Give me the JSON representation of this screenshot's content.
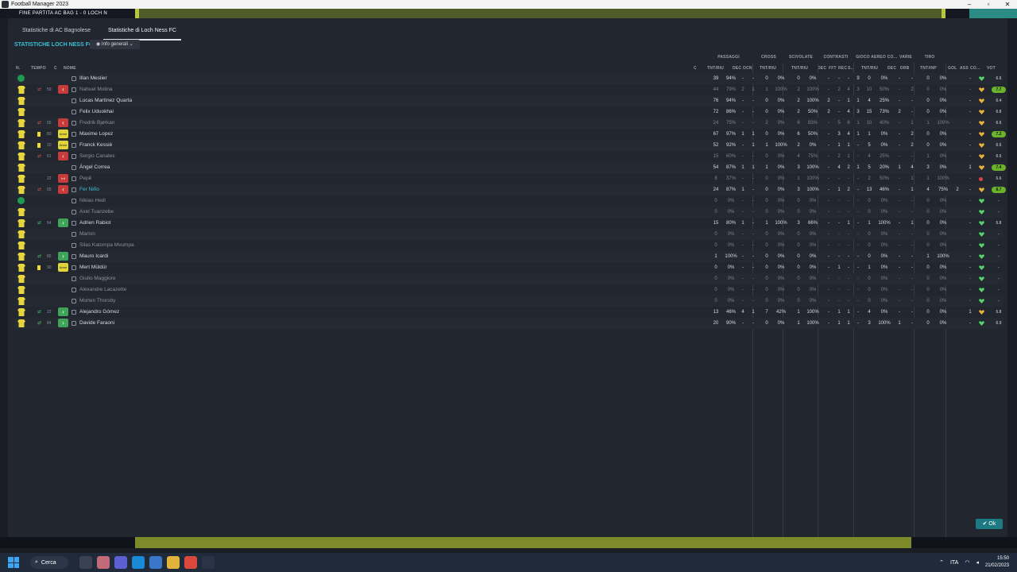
{
  "window": {
    "title": "Football Manager 2023"
  },
  "gamebar": {
    "left_text": "FINE PARTITA   AC BAG   1 - 0   LOCH N"
  },
  "tabs": [
    {
      "label": "Statistiche di AC Bagnolese"
    },
    {
      "label": "Statistiche di Loch Ness FC"
    }
  ],
  "section_title": "STATISTICHE LOCH NESS FC",
  "view_dropdown": {
    "label": "Info generali"
  },
  "groups": [
    "PASSAGGI",
    "CROSS",
    "SCIVOLATE",
    "CONTRASTI",
    "GIOCO AEREO",
    "CO...",
    "VARIE",
    "TIRO"
  ],
  "columns": {
    "n": "N.",
    "tempo": "TEMPO",
    "c": "C",
    "nome": "NOME",
    "cc": "C",
    "pass_tnt": "TNT/RIU",
    "pass_dec": "DEC",
    "pass_occ": "OCN",
    "cross_tnt": "TNT/RIU",
    "sciv_tnt": "TNT/RIU",
    "con_dec": "DEC",
    "con_fft": "FFT",
    "con_rec": "REC",
    "con_s": "S...",
    "aereo_tnt": "TNT/RIU",
    "co_dec": "DEC",
    "varie_drb": "DRB",
    "tiro_tnt": "TNT/INP",
    "gol": "GOL",
    "ass": "ASS",
    "co2": "CO...",
    "vot": "VOT"
  },
  "players": [
    {
      "name": "Illan Meslier",
      "state": "normal",
      "badge": "pos",
      "mins": "",
      "pass": "39",
      "passp": "94%",
      "pdec": "-",
      "pocc": "-",
      "cr": "0",
      "crp": "0%",
      "sc": "0",
      "scp": "0%",
      "cd": "-",
      "cf": "-",
      "cre": "-",
      "cs": "9",
      "ae": "0",
      "aep": "0%",
      "cod": "-",
      "drb": "-",
      "ti": "0",
      "tip": "0%",
      "gol": "",
      "ass": "-",
      "mood": "g",
      "vot": "6.6",
      "votpill": false
    },
    {
      "name": "Nahuel Molina",
      "state": "dim",
      "badge": "out",
      "mins": "59",
      "pass": "44",
      "passp": "79%",
      "pdec": "2",
      "pocc": "1",
      "cr": "1",
      "crp": "100%",
      "sc": "2",
      "scp": "100%",
      "cd": "-",
      "cf": "2",
      "cre": "4",
      "cs": "3",
      "ae": "10",
      "aep": "50%",
      "cod": "-",
      "drb": "2",
      "ti": "0",
      "tip": "0%",
      "gol": "",
      "ass": "-",
      "mood": "y",
      "vot": "7.7",
      "votpill": true
    },
    {
      "name": "Lucas Martínez Quarta",
      "state": "normal",
      "badge": "",
      "mins": "",
      "pass": "76",
      "passp": "94%",
      "pdec": "-",
      "pocc": "-",
      "cr": "0",
      "crp": "0%",
      "sc": "2",
      "scp": "100%",
      "cd": "2",
      "cf": "-",
      "cre": "1",
      "cs": "1",
      "ae": "4",
      "aep": "25%",
      "cod": "-",
      "drb": "-",
      "ti": "0",
      "tip": "0%",
      "gol": "",
      "ass": "-",
      "mood": "y",
      "vot": "6.4",
      "votpill": false
    },
    {
      "name": "Felix Uduokhai",
      "state": "normal",
      "badge": "",
      "mins": "",
      "pass": "72",
      "passp": "86%",
      "pdec": "-",
      "pocc": "-",
      "cr": "0",
      "crp": "0%",
      "sc": "2",
      "scp": "50%",
      "cd": "2",
      "cf": "-",
      "cre": "4",
      "cs": "3",
      "ae": "15",
      "aep": "73%",
      "cod": "2",
      "drb": "-",
      "ti": "0",
      "tip": "0%",
      "gol": "",
      "ass": "-",
      "mood": "y",
      "vot": "6.8",
      "votpill": false
    },
    {
      "name": "Fredrik Bjørkan",
      "state": "dim",
      "badge": "out",
      "mins": "55",
      "pass": "24",
      "passp": "75%",
      "pdec": "-",
      "pocc": "-",
      "cr": "2",
      "crp": "0%",
      "sc": "6",
      "scp": "83%",
      "cd": "-",
      "cf": "5",
      "cre": "6",
      "cs": "1",
      "ae": "10",
      "aep": "40%",
      "cod": "-",
      "drb": "1",
      "ti": "1",
      "tip": "100%",
      "gol": "",
      "ass": "-",
      "mood": "y",
      "vot": "6.6",
      "votpill": false
    },
    {
      "name": "Maxime Lopez",
      "state": "normal",
      "badge": "card",
      "mins": "80",
      "pass": "67",
      "passp": "97%",
      "pdec": "1",
      "pocc": "1",
      "cr": "0",
      "crp": "0%",
      "sc": "6",
      "scp": "50%",
      "cd": "-",
      "cf": "3",
      "cre": "4",
      "cs": "1",
      "ae": "1",
      "aep": "0%",
      "cod": "-",
      "drb": "2",
      "ti": "0",
      "tip": "0%",
      "gol": "",
      "ass": "-",
      "mood": "y",
      "vot": "7.2",
      "votpill": true
    },
    {
      "name": "Franck Kessié",
      "state": "normal",
      "badge": "card",
      "mins": "10",
      "pass": "52",
      "passp": "92%",
      "pdec": "-",
      "pocc": "1",
      "cr": "1",
      "crp": "100%",
      "sc": "2",
      "scp": "0%",
      "cd": "-",
      "cf": "1",
      "cre": "1",
      "cs": "-",
      "ae": "5",
      "aep": "0%",
      "cod": "-",
      "drb": "2",
      "ti": "0",
      "tip": "0%",
      "gol": "",
      "ass": "-",
      "mood": "y",
      "vot": "6.6",
      "votpill": false
    },
    {
      "name": "Sergio Canales",
      "state": "dim",
      "badge": "out",
      "mins": "61",
      "pass": "15",
      "passp": "60%",
      "pdec": "-",
      "pocc": "-",
      "cr": "0",
      "crp": "0%",
      "sc": "4",
      "scp": "75%",
      "cd": "-",
      "cf": "2",
      "cre": "1",
      "cs": "-",
      "ae": "4",
      "aep": "25%",
      "cod": "-",
      "drb": "-",
      "ti": "1",
      "tip": "0%",
      "gol": "",
      "ass": "-",
      "mood": "y",
      "vot": "6.6",
      "votpill": false
    },
    {
      "name": "Ángel Correa",
      "state": "normal",
      "badge": "",
      "mins": "",
      "pass": "54",
      "passp": "87%",
      "pdec": "1",
      "pocc": "1",
      "cr": "1",
      "crp": "0%",
      "sc": "3",
      "scp": "100%",
      "cd": "-",
      "cf": "4",
      "cre": "2",
      "cs": "1",
      "ae": "5",
      "aep": "20%",
      "cod": "1",
      "drb": "4",
      "ti": "3",
      "tip": "0%",
      "gol": "",
      "ass": "1",
      "mood": "y",
      "vot": "7.4",
      "votpill": true
    },
    {
      "name": "Pepê",
      "state": "dim",
      "badge": "inj",
      "mins": "22",
      "pass": "8",
      "passp": "37%",
      "pdec": "-",
      "pocc": "-",
      "cr": "0",
      "crp": "0%",
      "sc": "1",
      "scp": "100%",
      "cd": "-",
      "cf": "-",
      "cre": "-",
      "cs": "-",
      "ae": "2",
      "aep": "50%",
      "cod": "-",
      "drb": "1",
      "ti": "1",
      "tip": "100%",
      "gol": "",
      "ass": "-",
      "mood": "r",
      "vot": "6.6",
      "votpill": false
    },
    {
      "name": "Fer Niño",
      "state": "hl",
      "badge": "out",
      "mins": "55",
      "pass": "24",
      "passp": "87%",
      "pdec": "1",
      "pocc": "-",
      "cr": "0",
      "crp": "0%",
      "sc": "3",
      "scp": "100%",
      "cd": "-",
      "cf": "1",
      "cre": "2",
      "cs": "-",
      "ae": "13",
      "aep": "46%",
      "cod": "-",
      "drb": "1",
      "ti": "4",
      "tip": "75%",
      "gol": "2",
      "ass": "-",
      "mood": "y",
      "vot": "8.7",
      "votpill": true
    },
    {
      "name": "Niklas Hedl",
      "state": "dim",
      "badge": "pos",
      "mins": "",
      "pass": "0",
      "passp": "0%",
      "pdec": "-",
      "pocc": "-",
      "cr": "0",
      "crp": "0%",
      "sc": "0",
      "scp": "0%",
      "cd": "-",
      "cf": "-",
      "cre": "-",
      "cs": "-",
      "ae": "0",
      "aep": "0%",
      "cod": "-",
      "drb": "-",
      "ti": "0",
      "tip": "0%",
      "gol": "",
      "ass": "-",
      "mood": "g",
      "vot": "-",
      "votpill": false
    },
    {
      "name": "Axel Tuanzebe",
      "state": "dim",
      "badge": "",
      "mins": "",
      "pass": "0",
      "passp": "0%",
      "pdec": "-",
      "pocc": "-",
      "cr": "0",
      "crp": "0%",
      "sc": "0",
      "scp": "0%",
      "cd": "-",
      "cf": "-",
      "cre": "-",
      "cs": "-",
      "ae": "0",
      "aep": "0%",
      "cod": "-",
      "drb": "-",
      "ti": "0",
      "tip": "0%",
      "gol": "",
      "ass": "-",
      "mood": "g",
      "vot": "-",
      "votpill": false
    },
    {
      "name": "Adrien Rabiot",
      "state": "normal",
      "badge": "in",
      "mins": "64",
      "pass": "15",
      "passp": "80%",
      "pdec": "1",
      "pocc": "-",
      "cr": "1",
      "crp": "100%",
      "sc": "3",
      "scp": "66%",
      "cd": "-",
      "cf": "-",
      "cre": "1",
      "cs": "-",
      "ae": "1",
      "aep": "100%",
      "cod": "-",
      "drb": "1",
      "ti": "0",
      "tip": "0%",
      "gol": "",
      "ass": "-",
      "mood": "g",
      "vot": "6.8",
      "votpill": false
    },
    {
      "name": "Marlon",
      "state": "dim",
      "badge": "",
      "mins": "",
      "pass": "0",
      "passp": "0%",
      "pdec": "-",
      "pocc": "-",
      "cr": "0",
      "crp": "0%",
      "sc": "0",
      "scp": "0%",
      "cd": "-",
      "cf": "-",
      "cre": "-",
      "cs": "-",
      "ae": "0",
      "aep": "0%",
      "cod": "-",
      "drb": "-",
      "ti": "0",
      "tip": "0%",
      "gol": "",
      "ass": "-",
      "mood": "g",
      "vot": "-",
      "votpill": false
    },
    {
      "name": "Silas Katompa Mvumpa",
      "state": "dim",
      "badge": "",
      "mins": "",
      "pass": "0",
      "passp": "0%",
      "pdec": "-",
      "pocc": "-",
      "cr": "0",
      "crp": "0%",
      "sc": "0",
      "scp": "0%",
      "cd": "-",
      "cf": "-",
      "cre": "-",
      "cs": "-",
      "ae": "0",
      "aep": "0%",
      "cod": "-",
      "drb": "-",
      "ti": "0",
      "tip": "0%",
      "gol": "",
      "ass": "-",
      "mood": "g",
      "vot": "-",
      "votpill": false
    },
    {
      "name": "Mauro Icardi",
      "state": "normal",
      "badge": "in",
      "mins": "85",
      "pass": "1",
      "passp": "100%",
      "pdec": "-",
      "pocc": "-",
      "cr": "0",
      "crp": "0%",
      "sc": "0",
      "scp": "0%",
      "cd": "-",
      "cf": "-",
      "cre": "-",
      "cs": "-",
      "ae": "0",
      "aep": "0%",
      "cod": "-",
      "drb": "-",
      "ti": "1",
      "tip": "100%",
      "gol": "",
      "ass": "-",
      "mood": "g",
      "vot": "-",
      "votpill": false
    },
    {
      "name": "Mert Müldür",
      "state": "normal",
      "badge": "card",
      "mins": "90",
      "pass": "0",
      "passp": "0%",
      "pdec": "-",
      "pocc": "-",
      "cr": "0",
      "crp": "0%",
      "sc": "0",
      "scp": "0%",
      "cd": "-",
      "cf": "1",
      "cre": "-",
      "cs": "-",
      "ae": "1",
      "aep": "0%",
      "cod": "-",
      "drb": "-",
      "ti": "0",
      "tip": "0%",
      "gol": "",
      "ass": "-",
      "mood": "g",
      "vot": "-",
      "votpill": false
    },
    {
      "name": "Giulio Maggiore",
      "state": "dim",
      "badge": "",
      "mins": "",
      "pass": "0",
      "passp": "0%",
      "pdec": "-",
      "pocc": "-",
      "cr": "0",
      "crp": "0%",
      "sc": "0",
      "scp": "0%",
      "cd": "-",
      "cf": "-",
      "cre": "-",
      "cs": "-",
      "ae": "0",
      "aep": "0%",
      "cod": "-",
      "drb": "-",
      "ti": "0",
      "tip": "0%",
      "gol": "",
      "ass": "-",
      "mood": "g",
      "vot": "-",
      "votpill": false
    },
    {
      "name": "Alexandre Lacazette",
      "state": "dim",
      "badge": "",
      "mins": "",
      "pass": "0",
      "passp": "0%",
      "pdec": "-",
      "pocc": "-",
      "cr": "0",
      "crp": "0%",
      "sc": "0",
      "scp": "0%",
      "cd": "-",
      "cf": "-",
      "cre": "-",
      "cs": "-",
      "ae": "0",
      "aep": "0%",
      "cod": "-",
      "drb": "-",
      "ti": "0",
      "tip": "0%",
      "gol": "",
      "ass": "-",
      "mood": "g",
      "vot": "-",
      "votpill": false
    },
    {
      "name": "Morten Thorsby",
      "state": "dim",
      "badge": "",
      "mins": "",
      "pass": "0",
      "passp": "0%",
      "pdec": "-",
      "pocc": "-",
      "cr": "0",
      "crp": "0%",
      "sc": "0",
      "scp": "0%",
      "cd": "-",
      "cf": "-",
      "cre": "-",
      "cs": "-",
      "ae": "0",
      "aep": "0%",
      "cod": "-",
      "drb": "-",
      "ti": "0",
      "tip": "0%",
      "gol": "",
      "ass": "-",
      "mood": "g",
      "vot": "-",
      "votpill": false
    },
    {
      "name": "Alejandro Gómez",
      "state": "normal",
      "badge": "in",
      "mins": "22",
      "pass": "13",
      "passp": "46%",
      "pdec": "4",
      "pocc": "1",
      "cr": "7",
      "crp": "42%",
      "sc": "1",
      "scp": "100%",
      "cd": "-",
      "cf": "1",
      "cre": "1",
      "cs": "-",
      "ae": "4",
      "aep": "0%",
      "cod": "-",
      "drb": "-",
      "ti": "0",
      "tip": "0%",
      "gol": "",
      "ass": "1",
      "mood": "y",
      "vot": "6.8",
      "votpill": false
    },
    {
      "name": "Davide Faraoni",
      "state": "normal",
      "badge": "in",
      "mins": "84",
      "pass": "20",
      "passp": "90%",
      "pdec": "-",
      "pocc": "-",
      "cr": "0",
      "crp": "0%",
      "sc": "1",
      "scp": "100%",
      "cd": "-",
      "cf": "1",
      "cre": "1",
      "cs": "-",
      "ae": "3",
      "aep": "100%",
      "cod": "1",
      "drb": "-",
      "ti": "0",
      "tip": "0%",
      "gol": "",
      "ass": "-",
      "mood": "g",
      "vot": "6.9",
      "votpill": false
    }
  ],
  "badge_text": {
    "card": "Amm",
    "inj": "Inf"
  },
  "ok_button": {
    "label": "✔ Ok"
  },
  "taskbar": {
    "search": "Cerca",
    "lang": "ITA",
    "time": "15:50",
    "date": "21/02/2023"
  },
  "colors": {
    "accent": "#3cc0d8",
    "ok": "#1d7a82",
    "bar": "#b7c63a",
    "pill": "#6cb32c"
  }
}
